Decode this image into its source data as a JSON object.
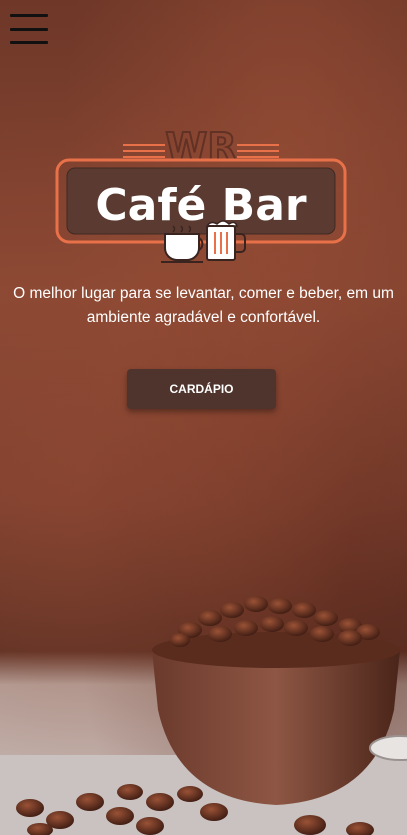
{
  "header": {
    "menu_icon": "hamburger-menu-icon"
  },
  "logo": {
    "monogram": "WR",
    "title": "Café Bar",
    "icons": [
      "coffee-cup-icon",
      "beer-mug-icon"
    ]
  },
  "hero": {
    "tagline": "O melhor lugar para se levantar, comer e beber, em um ambiente agradável e confortável.",
    "cta_label": "CARDÁPIO"
  },
  "colors": {
    "accent": "#e8714a",
    "button": "#4e342c",
    "background": "#7a3f2c"
  },
  "illustration": {
    "subject": "coffee-beans-bowl"
  }
}
